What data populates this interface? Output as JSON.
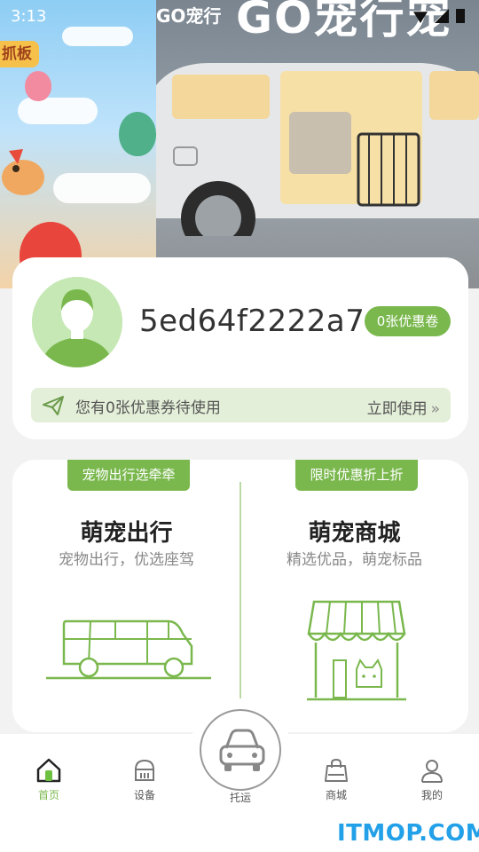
{
  "status_bar": {
    "time": "3:13"
  },
  "banner": {
    "left_sign": "抓板",
    "brand_text": "GO宠行",
    "brand_big": "GO宠行宠"
  },
  "profile": {
    "username": "5ed64f2222a7",
    "coupon_badge": "0张优惠卷",
    "coupon_message": "您有0张优惠券待使用",
    "coupon_action": "立即使用"
  },
  "services": {
    "left": {
      "tag": "宠物出行选牵牵",
      "title": "萌宠出行",
      "subtitle": "宠物出行，优选座驾"
    },
    "right": {
      "tag": "限时优惠折上折",
      "title": "萌宠商城",
      "subtitle": "精选优品，萌宠标品"
    }
  },
  "nav": {
    "items": [
      {
        "label": "首页",
        "icon": "home-icon",
        "active": true
      },
      {
        "label": "设备",
        "icon": "device-icon"
      },
      {
        "label": "托运",
        "icon": "car-icon"
      },
      {
        "label": "商城",
        "icon": "shopping-bag-icon"
      },
      {
        "label": "我的",
        "icon": "user-icon"
      }
    ]
  },
  "watermark": "ITMOP.COM",
  "colors": {
    "accent": "#7ab84e",
    "accent_light": "#e3efd8",
    "watermark": "#22a0e8"
  }
}
